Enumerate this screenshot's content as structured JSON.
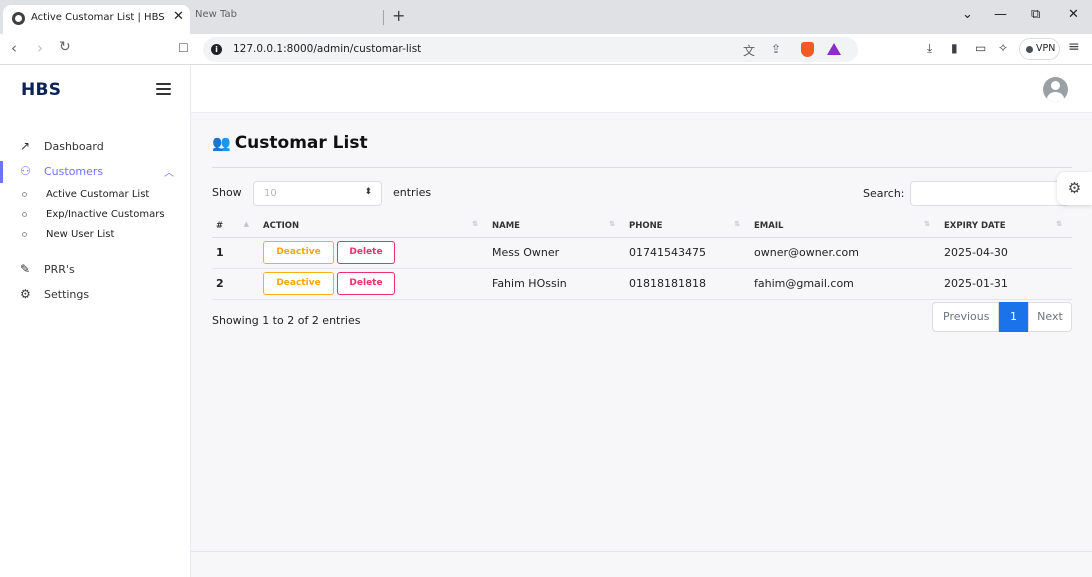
{
  "browser": {
    "active_tab_title": "Active Customar List | HBS",
    "inactive_tab_title": "New Tab",
    "url": "127.0.0.1:8000/admin/customar-list",
    "vpn_label": "VPN"
  },
  "app": {
    "brand": "HBS",
    "page_title": "Customar List",
    "accent_color": "#6d72ff"
  },
  "sidebar": {
    "items": [
      {
        "label": "Dashboard",
        "icon": "trend-up-icon"
      },
      {
        "label": "Customers",
        "icon": "users-icon",
        "active": true,
        "expanded": true
      },
      {
        "label": "PRR's",
        "icon": "edit-icon"
      },
      {
        "label": "Settings",
        "icon": "gear-icon"
      }
    ],
    "sub_items": [
      {
        "label": "Active Customar List"
      },
      {
        "label": "Exp/Inactive Customars"
      },
      {
        "label": "New User List"
      }
    ]
  },
  "table_controls": {
    "show_label": "Show",
    "page_length": "10",
    "entries_label": "entries",
    "search_label": "Search:"
  },
  "table": {
    "columns": [
      "#",
      "ACTION",
      "NAME",
      "PHONE",
      "EMAIL",
      "EXPIRY DATE"
    ],
    "rows": [
      {
        "num": "1",
        "name": "Mess Owner",
        "phone": "01741543475",
        "email": "owner@owner.com",
        "expiry": "2025-04-30"
      },
      {
        "num": "2",
        "name": "Fahim HOssin",
        "phone": "01818181818",
        "email": "fahim@gmail.com",
        "expiry": "2025-01-31"
      }
    ],
    "deactive_label": "Deactive",
    "delete_label": "Delete"
  },
  "footer": {
    "info": "Showing 1 to 2 of 2 entries",
    "prev_label": "Previous",
    "current_page": "1",
    "next_label": "Next"
  }
}
